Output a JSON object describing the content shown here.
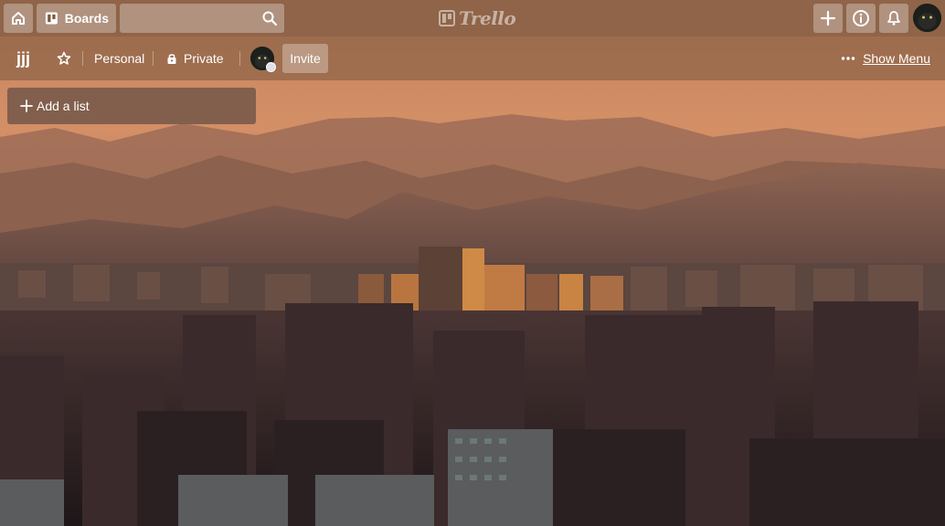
{
  "header": {
    "boards_label": "Boards",
    "search_placeholder": "",
    "logo_text": "Trello",
    "icons": [
      "home-icon",
      "boards-icon",
      "search-icon",
      "plus-icon",
      "info-icon",
      "bell-icon"
    ]
  },
  "board": {
    "title": "jjj",
    "team_label": "Personal",
    "visibility_label": "Private",
    "invite_label": "Invite",
    "menu_label": "Show Menu"
  },
  "lists": {
    "add_list_label": "Add a list"
  },
  "colors": {
    "header_bg": "#7a583e",
    "add_list_bg": "#76594a",
    "sky_top": "#d58d61",
    "mountain_far": "#9a6a55",
    "city_dark": "#2a1d1f"
  }
}
